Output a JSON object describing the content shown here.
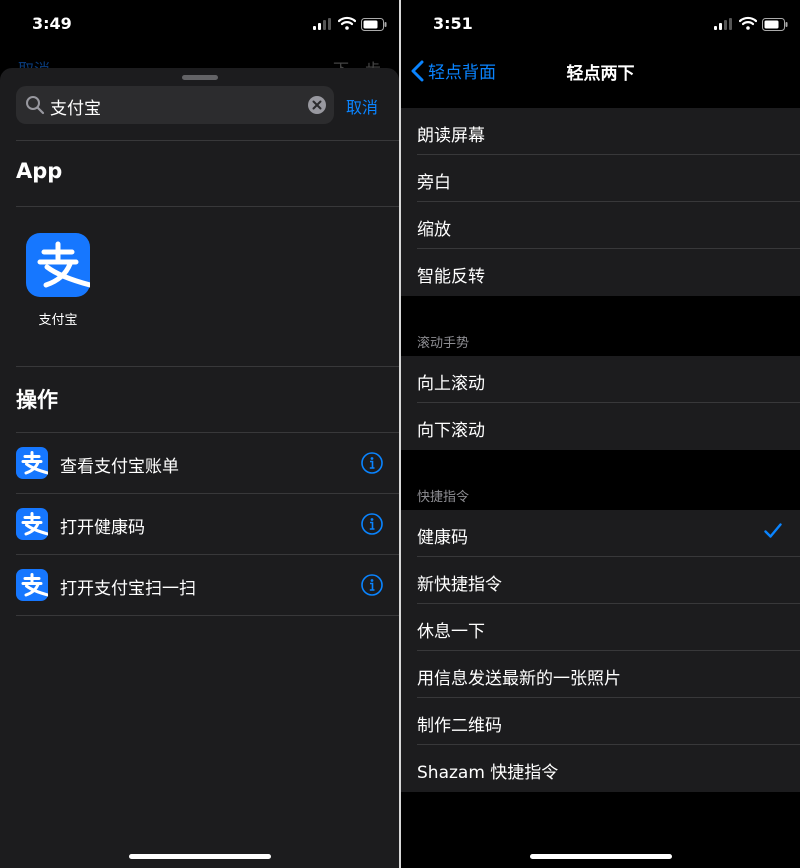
{
  "colors": {
    "accent": "#0a84ff",
    "alipay_blue": "#1677ff",
    "sheet_bg": "#1c1c1e",
    "background": "#000000"
  },
  "left": {
    "status": {
      "time": "3:49"
    },
    "behind_nav": {
      "cancel": "取消",
      "next": "下一步"
    },
    "search": {
      "query": "支付宝",
      "cancel_label": "取消",
      "search_icon": "magnifier-icon",
      "clear_icon": "clear-circle-icon"
    },
    "app_section": {
      "title": "App",
      "apps": [
        {
          "label": "支付宝",
          "icon": "alipay-icon"
        }
      ]
    },
    "actions_section": {
      "title": "操作",
      "items": [
        {
          "label": "查看支付宝账单",
          "icon": "alipay-icon",
          "info_icon": "info-icon"
        },
        {
          "label": "打开健康码",
          "icon": "alipay-icon",
          "info_icon": "info-icon"
        },
        {
          "label": "打开支付宝扫一扫",
          "icon": "alipay-icon",
          "info_icon": "info-icon"
        }
      ]
    }
  },
  "right": {
    "status": {
      "time": "3:51"
    },
    "nav": {
      "back_label": "轻点背面",
      "title": "轻点两下"
    },
    "accessibility_items": [
      {
        "label": "朗读屏幕"
      },
      {
        "label": "旁白"
      },
      {
        "label": "缩放"
      },
      {
        "label": "智能反转"
      }
    ],
    "scroll_section": {
      "header": "滚动手势",
      "items": [
        {
          "label": "向上滚动"
        },
        {
          "label": "向下滚动"
        }
      ]
    },
    "shortcuts_section": {
      "header": "快捷指令",
      "items": [
        {
          "label": "健康码",
          "selected": true
        },
        {
          "label": "新快捷指令"
        },
        {
          "label": "休息一下"
        },
        {
          "label": "用信息发送最新的一张照片"
        },
        {
          "label": "制作二维码"
        },
        {
          "label": "Shazam 快捷指令"
        }
      ]
    }
  }
}
